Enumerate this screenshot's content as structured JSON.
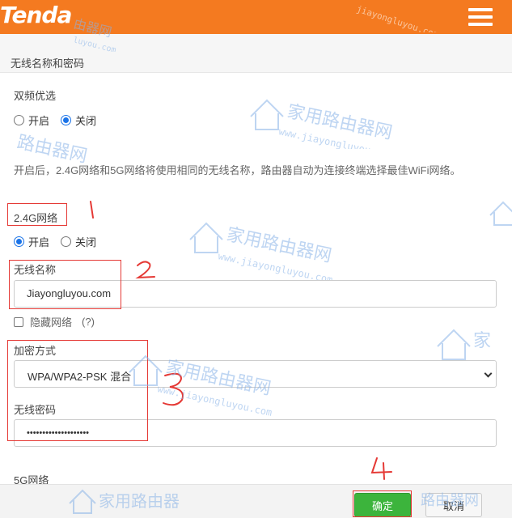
{
  "header": {
    "logo_text": "Tenda",
    "menu_icon": "hamburger-menu-icon",
    "brand_color": "#f47a20"
  },
  "section": {
    "title": "无线名称和密码"
  },
  "dual_band": {
    "label": "双频优选",
    "options": [
      "开启",
      "关闭"
    ],
    "selected": "关闭",
    "description": "开启后，2.4G网络和5G网络将使用相同的无线名称，路由器自动为连接终端选择最佳WiFi网络。"
  },
  "band_24g": {
    "label": "2.4G网络",
    "options": [
      "开启",
      "关闭"
    ],
    "selected": "开启",
    "ssid_label": "无线名称",
    "ssid_value": "Jiayongluyou.com",
    "hide_network_label": "隐藏网络",
    "hide_network_help": "(?)",
    "hide_network_checked": false,
    "encryption_label": "加密方式",
    "encryption_value": "WPA/WPA2-PSK 混合",
    "password_label": "无线密码",
    "password_masked": "••••••••••••••••••••"
  },
  "band_5g": {
    "label": "5G网络"
  },
  "footer": {
    "ok_label": "确定",
    "cancel_label": "取消",
    "ok_color": "#3cb43c"
  },
  "annotations": {
    "color": "#e53935",
    "marks": [
      "1",
      "2",
      "3",
      "4"
    ]
  },
  "watermark": {
    "text_cn": "家用路由器网",
    "text_en": "www.jiayongluyou.com",
    "color": "#8ab4e8"
  }
}
